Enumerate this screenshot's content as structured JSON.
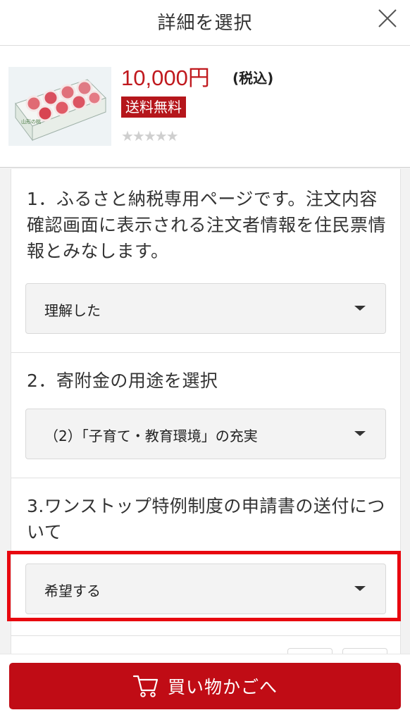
{
  "header": {
    "title": "詳細を選択",
    "close_icon": "close-icon"
  },
  "product": {
    "price": "10,000",
    "currency": "円",
    "tax_note": "(税込)",
    "badge": "送料無料",
    "stars": "★★★★★",
    "rating_count_stars": 0,
    "accent_color": "#c0191e"
  },
  "questions": [
    {
      "text": "1．ふるさと納税専用ページです。注文内容確認画面に表示される注文者情報を住民票情報とみなします。",
      "value": "理解した"
    },
    {
      "text": "2．寄附金の用途を選択",
      "value": "（2）「子育て・教育環境」の充実"
    },
    {
      "text": "3.ワンストップ特例制度の申請書の送付について",
      "value": "希望する"
    }
  ],
  "footer": {
    "cart_label": "買い物かごへ",
    "cart_icon": "cart-icon",
    "button_color": "#c00c15"
  }
}
